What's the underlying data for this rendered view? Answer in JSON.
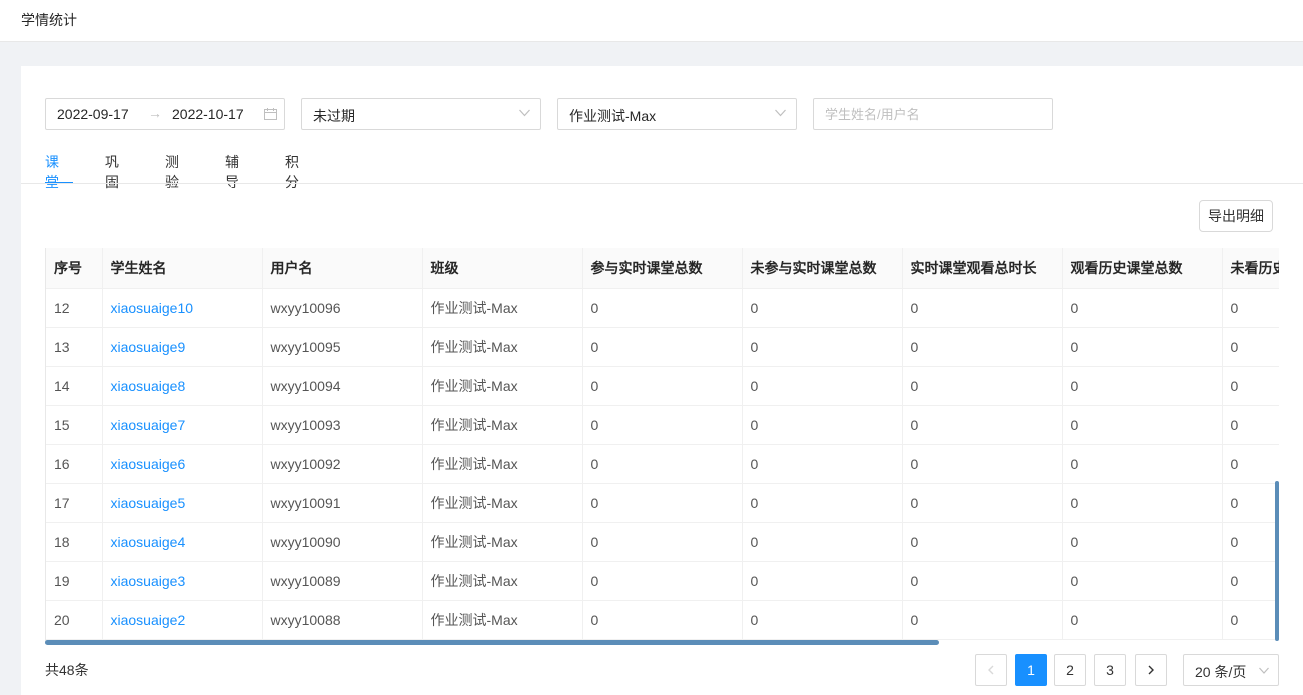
{
  "header": {
    "title": "学情统计"
  },
  "filters": {
    "date_start": "2022-09-17",
    "date_separator": "→",
    "date_end": "2022-10-17",
    "status_value": "未过期",
    "class_value": "作业测试-Max",
    "search_placeholder": "学生姓名/用户名"
  },
  "tabs": [
    {
      "label": "课堂",
      "active": true
    },
    {
      "label": "巩固"
    },
    {
      "label": "测验"
    },
    {
      "label": "辅导"
    },
    {
      "label": "积分"
    }
  ],
  "toolbar": {
    "export_label": "导出明细"
  },
  "table": {
    "columns": [
      "序号",
      "学生姓名",
      "用户名",
      "班级",
      "参与实时课堂总数",
      "未参与实时课堂总数",
      "实时课堂观看总时长",
      "观看历史课堂总数",
      "未看历史课堂总数"
    ],
    "rows": [
      [
        "12",
        "xiaosuaige10",
        "wxyy10096",
        "作业测试-Max",
        "0",
        "0",
        "0",
        "0",
        "0"
      ],
      [
        "13",
        "xiaosuaige9",
        "wxyy10095",
        "作业测试-Max",
        "0",
        "0",
        "0",
        "0",
        "0"
      ],
      [
        "14",
        "xiaosuaige8",
        "wxyy10094",
        "作业测试-Max",
        "0",
        "0",
        "0",
        "0",
        "0"
      ],
      [
        "15",
        "xiaosuaige7",
        "wxyy10093",
        "作业测试-Max",
        "0",
        "0",
        "0",
        "0",
        "0"
      ],
      [
        "16",
        "xiaosuaige6",
        "wxyy10092",
        "作业测试-Max",
        "0",
        "0",
        "0",
        "0",
        "0"
      ],
      [
        "17",
        "xiaosuaige5",
        "wxyy10091",
        "作业测试-Max",
        "0",
        "0",
        "0",
        "0",
        "0"
      ],
      [
        "18",
        "xiaosuaige4",
        "wxyy10090",
        "作业测试-Max",
        "0",
        "0",
        "0",
        "0",
        "0"
      ],
      [
        "19",
        "xiaosuaige3",
        "wxyy10089",
        "作业测试-Max",
        "0",
        "0",
        "0",
        "0",
        "0"
      ],
      [
        "20",
        "xiaosuaige2",
        "wxyy10088",
        "作业测试-Max",
        "0",
        "0",
        "0",
        "0",
        "0"
      ]
    ]
  },
  "pagination": {
    "total_text": "共48条",
    "pages": [
      "1",
      "2",
      "3"
    ],
    "current": "1",
    "page_size": "20 条/页"
  },
  "colors": {
    "accent": "#1890ff",
    "scrollbar": "#5b8db8"
  },
  "icons": [
    "calendar-icon",
    "chevron-down-icon",
    "chevron-left-icon",
    "chevron-right-icon"
  ]
}
